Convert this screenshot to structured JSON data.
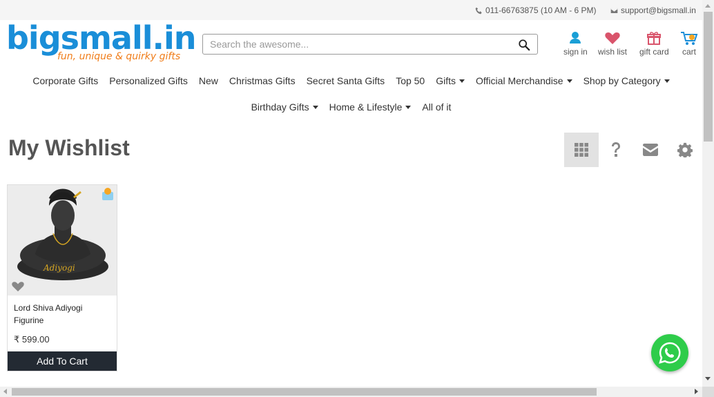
{
  "topbar": {
    "phone": "011-66763875 (10 AM - 6 PM)",
    "email": "support@bigsmall.in"
  },
  "logo": {
    "brand": "bigsmall.in",
    "tagline": "fun, unique & quirky gifts"
  },
  "search": {
    "placeholder": "Search the awesome..."
  },
  "header_icons": {
    "sign_in": "sign in",
    "wish_list": "wish list",
    "gift_card": "gift card",
    "cart": "cart"
  },
  "nav": {
    "row1": [
      {
        "label": "Corporate Gifts",
        "dropdown": false
      },
      {
        "label": "Personalized Gifts",
        "dropdown": false
      },
      {
        "label": "New",
        "dropdown": false
      },
      {
        "label": "Christmas Gifts",
        "dropdown": false
      },
      {
        "label": "Secret Santa Gifts",
        "dropdown": false
      },
      {
        "label": "Top 50",
        "dropdown": false
      },
      {
        "label": "Gifts",
        "dropdown": true
      },
      {
        "label": "Official Merchandise",
        "dropdown": true
      },
      {
        "label": "Shop by Category",
        "dropdown": true
      }
    ],
    "row2": [
      {
        "label": "Birthday Gifts",
        "dropdown": true
      },
      {
        "label": "Home & Lifestyle",
        "dropdown": true
      },
      {
        "label": "All of it",
        "dropdown": false
      }
    ]
  },
  "page": {
    "title": "My Wishlist"
  },
  "toolbar": {
    "grid_icon": "grid-view-icon",
    "help_icon": "question-icon",
    "email_icon": "envelope-icon",
    "settings_icon": "gear-icon"
  },
  "product": {
    "name": "Lord Shiva Adiyogi Figurine",
    "price": "₹ 599.00",
    "add_to_cart": "Add To Cart",
    "image_text": "Adiyogi"
  },
  "colors": {
    "brand_blue": "#1a8ed8",
    "brand_orange": "#f07d1a",
    "heart_pink": "#d9546b",
    "cart_button": "#232a33",
    "whatsapp_green": "#2ecc4a"
  }
}
